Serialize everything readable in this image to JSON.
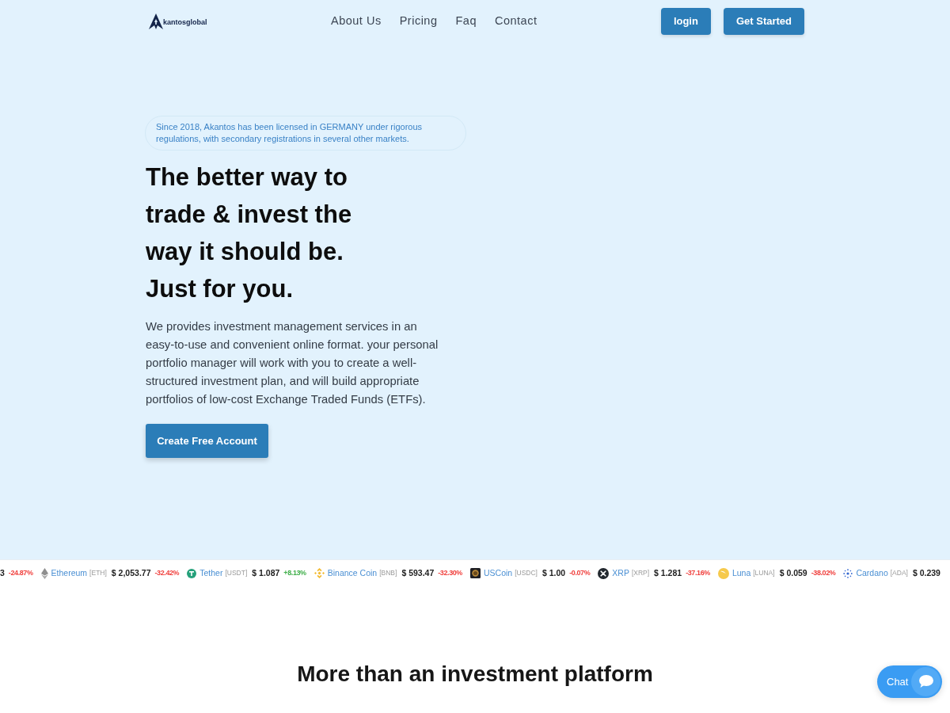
{
  "header": {
    "logo_text": "kantosglobal",
    "nav_links": [
      "About Us",
      "Pricing",
      "Faq",
      "Contact"
    ],
    "buttons": [
      {
        "label": "login"
      },
      {
        "label": "Get Started"
      }
    ]
  },
  "hero": {
    "notice": "Since 2018, Akantos has been licensed in GERMANY under rigorous regulations, with secondary registrations in several other markets.",
    "headline_lines": [
      "The better way to",
      "trade & invest the",
      "way it should be.",
      "Just for you."
    ],
    "description": "We provides investment management services in an easy-to-use and convenient online format. your personal portfolio manager will work with you to create a well-structured investment plan, and will build appropriate portfolios of low-cost Exchange Traded Funds (ETFs).",
    "cta": "Create Free Account"
  },
  "ticker": [
    {
      "kind": "partial",
      "price": "3",
      "change": "-24.87%",
      "color": "#f0413e"
    },
    {
      "kind": "eth",
      "name": "Ethereum",
      "symbol": "[ETH]",
      "price": "$ 2,053.77",
      "change": "-32.42%",
      "color": "#f0413e"
    },
    {
      "kind": "usdt",
      "name": "Tether",
      "symbol": "[USDT]",
      "price": "$ 1.087",
      "change": "+8.13%",
      "color": "#3fae49"
    },
    {
      "kind": "bnb",
      "name": "Binance Coin",
      "symbol": "[BNB]",
      "price": "$ 593.47",
      "change": "-32.30%",
      "color": "#f0413e"
    },
    {
      "kind": "usdc",
      "name": "USCoin",
      "symbol": "[USDC]",
      "price": "$ 1.00",
      "change": "-0.07%",
      "color": "#f0413e"
    },
    {
      "kind": "xrp",
      "name": "XRP",
      "symbol": "[XRP]",
      "price": "$ 1.281",
      "change": "-37.16%",
      "color": "#f0413e"
    },
    {
      "kind": "luna",
      "name": "Luna",
      "symbol": "[LUNA]",
      "price": "$ 0.059",
      "change": "-38.02%",
      "color": "#f0413e"
    },
    {
      "kind": "ada",
      "name": "Cardano",
      "symbol": "[ADA]",
      "price": "$ 0.239"
    }
  ],
  "section": {
    "title": "More than an investment platform"
  },
  "chat": {
    "label": "Chat"
  }
}
